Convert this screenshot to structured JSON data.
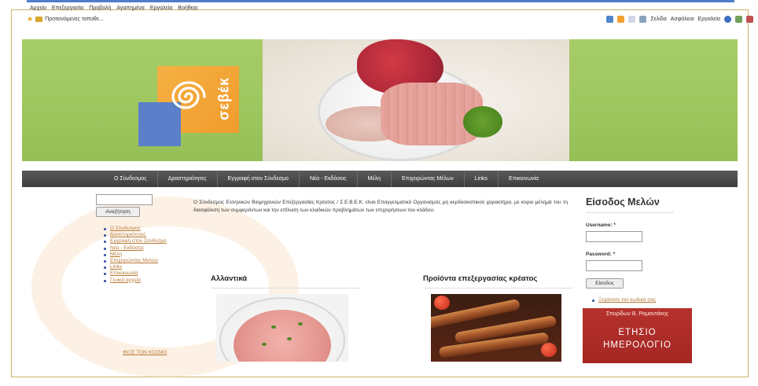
{
  "browser": {
    "menu": [
      "Αρχείο",
      "Επεξεργασία",
      "Προβολή",
      "Αγαπημένα",
      "Εργαλεία",
      "Βοήθεια"
    ],
    "favorites_label": "Προτεινόμενες τοποθε...",
    "toolbar": [
      "Σελίδα",
      "Ασφάλεια",
      "Εργαλεία"
    ]
  },
  "logo": {
    "text": "σεβέκ"
  },
  "nav": {
    "items": [
      "Ο Σύνδεσμος",
      "Δραστηριότητες",
      "Εγγραφή στον Σύνδεσμο",
      "Νέα - Εκδόσεις",
      "Μέλη",
      "Επιχειρώντας Μέλων",
      "Links",
      "Επικοινωνία"
    ]
  },
  "sidebar": {
    "search_button": "Αναζήτηση",
    "links": [
      "Ο Σύνδεσμος",
      "Δραστηριότητες",
      "Εγγραφή στον Σύνδεσμο",
      "Νέα - Εκδόσεις",
      "Μέλη",
      "Επιχειρώντας Μελών",
      "Links",
      "Επικοινωνία",
      "Γενικά αρχεία"
    ],
    "footer_link": "ΦΙΞΕ ΤΟΝ ΚΟΣΜΟ"
  },
  "content": {
    "intro": "Ο Σύνδεσμος Ελληνικών Βιομηχανιών Επεξεργασίας Κρέατος / Σ.Ε.Β.Ε.Κ. είναι Επαγγελματικό Οργανισμός μη κερδοσκοπικού χαρακτήρα, με κύριο μέλημά του τη διασφάλιση των συμφερόντων και την επίλυση των κλαδικών προβλημάτων των επιχειρήσεων του κλάδου.",
    "section_left": "Αλλαντικά",
    "section_right": "Προϊόντα επεξεργασίας κρέατος"
  },
  "login": {
    "title": "Είσοδος Μελών",
    "username_label": "Username:",
    "password_label": "Password:",
    "required_mark": "*",
    "button": "Είσοδος",
    "reset_link": "Ξεχάσατε τον κωδικό σας"
  },
  "ad": {
    "name": "Σπυρίδων Β. Ραμαντάκης",
    "line1": "ΕΤΗΣΙΟ",
    "line2": "ΗΜΕΡΟΛΟΓΙΟ"
  },
  "colors": {
    "header_green": "#a6cc67",
    "nav_dark": "#3d3d3d",
    "logo_orange": "#f09c2d",
    "logo_blue": "#5b7fc9",
    "link_color": "#b77935",
    "ad_red": "#a52723"
  }
}
